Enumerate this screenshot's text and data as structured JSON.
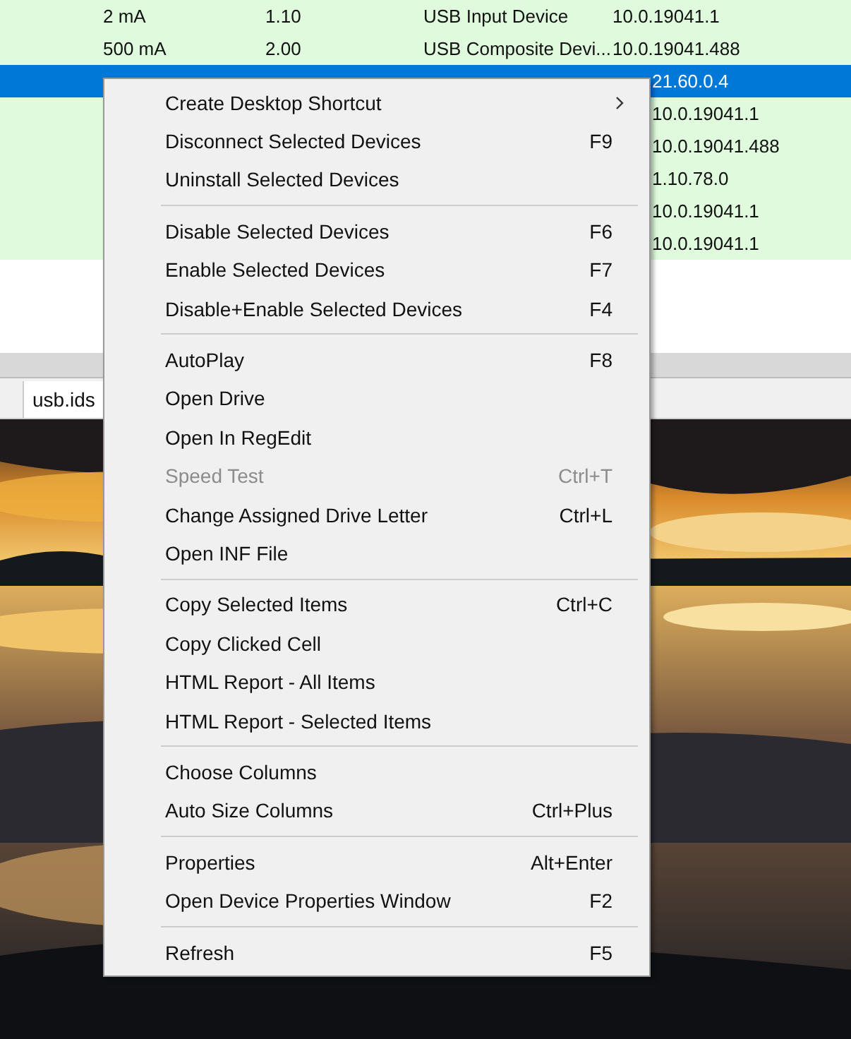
{
  "table": {
    "rows": [
      {
        "column_1": "2 mA",
        "column_2": "1.10",
        "column_3": "USB Input Device",
        "column_4": "10.0.19041.1",
        "selected": false
      },
      {
        "column_1": "500 mA",
        "column_2": "2.00",
        "column_3": "USB Composite Devi...",
        "column_4": "10.0.19041.488",
        "selected": false
      },
      {
        "column_4": "21.60.0.4",
        "selected": true
      },
      {
        "column_4": "10.0.19041.1",
        "selected": false
      },
      {
        "column_4": "10.0.19041.488",
        "selected": false
      },
      {
        "column_4": "1.10.78.0",
        "selected": false
      },
      {
        "column_4": "10.0.19041.1",
        "selected": false
      },
      {
        "column_4": "10.0.19041.1",
        "selected": false
      }
    ]
  },
  "tabs": [
    {
      "label": "usb.ids",
      "selected": true
    }
  ],
  "context_menu": {
    "groups": [
      [
        {
          "label": "Create Desktop Shortcut",
          "submenu": true,
          "disabled": false
        },
        {
          "label": "Disconnect Selected Devices",
          "shortcut": "F9",
          "submenu": false,
          "disabled": false
        },
        {
          "label": "Uninstall Selected Devices",
          "submenu": false,
          "disabled": false
        }
      ],
      [
        {
          "label": "Disable Selected Devices",
          "shortcut": "F6",
          "submenu": false,
          "disabled": false
        },
        {
          "label": "Enable Selected Devices",
          "shortcut": "F7",
          "submenu": false,
          "disabled": false
        },
        {
          "label": "Disable+Enable Selected Devices",
          "shortcut": "F4",
          "submenu": false,
          "disabled": false
        }
      ],
      [
        {
          "label": "AutoPlay",
          "shortcut": "F8",
          "submenu": false,
          "disabled": false
        },
        {
          "label": "Open Drive",
          "submenu": false,
          "disabled": false
        },
        {
          "label": "Open In RegEdit",
          "submenu": false,
          "disabled": false
        },
        {
          "label": "Speed Test",
          "shortcut": "Ctrl+T",
          "submenu": false,
          "disabled": true
        },
        {
          "label": "Change Assigned Drive Letter",
          "shortcut": "Ctrl+L",
          "submenu": false,
          "disabled": false
        },
        {
          "label": "Open INF File",
          "submenu": false,
          "disabled": false
        }
      ],
      [
        {
          "label": "Copy Selected Items",
          "shortcut": "Ctrl+C",
          "submenu": false,
          "disabled": false
        },
        {
          "label": "Copy Clicked Cell",
          "submenu": false,
          "disabled": false
        },
        {
          "label": "HTML Report - All Items",
          "submenu": false,
          "disabled": false
        },
        {
          "label": "HTML Report - Selected Items",
          "submenu": false,
          "disabled": false
        }
      ],
      [
        {
          "label": "Choose Columns",
          "submenu": false,
          "disabled": false
        },
        {
          "label": "Auto Size Columns",
          "shortcut": "Ctrl+Plus",
          "submenu": false,
          "disabled": false
        }
      ],
      [
        {
          "label": "Properties",
          "shortcut": "Alt+Enter",
          "submenu": false,
          "disabled": false
        },
        {
          "label": "Open Device Properties Window",
          "shortcut": "F2",
          "submenu": false,
          "disabled": false
        }
      ],
      [
        {
          "label": "Refresh",
          "shortcut": "F5",
          "submenu": false,
          "disabled": false
        }
      ]
    ]
  }
}
